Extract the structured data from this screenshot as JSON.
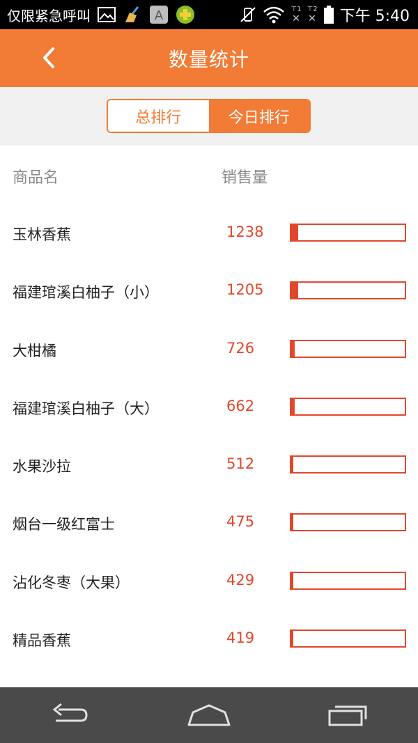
{
  "status_bar": {
    "carrier": "仅限紧急呼叫",
    "time": "下午 5:40",
    "sim1": "1",
    "sim2": "2",
    "icons": [
      "image-icon",
      "broom-icon",
      "keyboard-a-icon",
      "add-app-icon",
      "vibrate-off-icon",
      "wifi-icon",
      "sim1-no-signal-icon",
      "sim2-no-signal-icon",
      "battery-icon"
    ]
  },
  "header": {
    "title": "数量统计",
    "back_icon": "chevron-left-icon"
  },
  "tabs": {
    "items": [
      {
        "label": "总排行",
        "active": false
      },
      {
        "label": "今日排行",
        "active": true
      }
    ]
  },
  "columns": {
    "name": "商品名",
    "sales": "销售量"
  },
  "products": [
    {
      "name": "玉林香蕉",
      "sales": "1238",
      "bar_fraction": 0.06
    },
    {
      "name": "福建琯溪白柚子（小）",
      "sales": "1205",
      "bar_fraction": 0.06
    },
    {
      "name": "大柑橘",
      "sales": "726",
      "bar_fraction": 0.03
    },
    {
      "name": "福建琯溪白柚子（大）",
      "sales": "662",
      "bar_fraction": 0.03
    },
    {
      "name": "水果沙拉",
      "sales": "512",
      "bar_fraction": 0.02
    },
    {
      "name": "烟台一级红富士",
      "sales": "475",
      "bar_fraction": 0.02
    },
    {
      "name": "沾化冬枣（大果）",
      "sales": "429",
      "bar_fraction": 0.02
    },
    {
      "name": "精品香蕉",
      "sales": "419",
      "bar_fraction": 0.02
    }
  ],
  "colors": {
    "accent": "#f27b36",
    "value": "#e3472b"
  },
  "navbar": {
    "icons": [
      "back-arrow-icon",
      "home-icon",
      "recent-apps-icon"
    ]
  }
}
